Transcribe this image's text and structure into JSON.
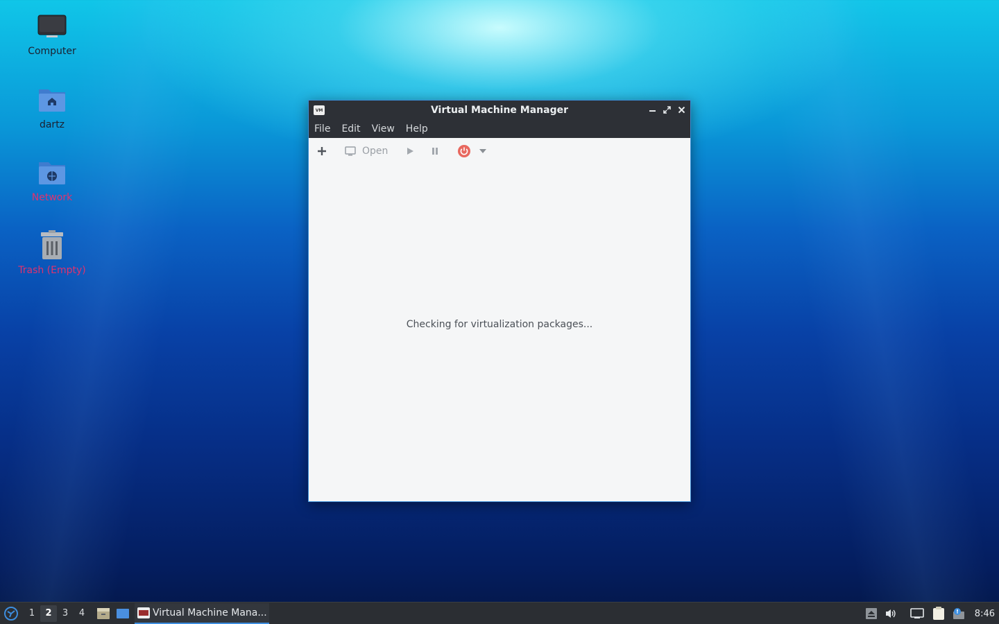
{
  "desktop": {
    "icons": [
      {
        "label": "Computer",
        "icon": "computer-icon"
      },
      {
        "label": "dartz",
        "icon": "home-folder-icon"
      },
      {
        "label": "Network",
        "icon": "network-folder-icon"
      },
      {
        "label": "Trash (Empty)",
        "icon": "trash-icon"
      }
    ]
  },
  "window": {
    "title": "Virtual Machine Manager",
    "app_icon_text": "VM",
    "menu": [
      "File",
      "Edit",
      "View",
      "Help"
    ],
    "toolbar": {
      "new_icon": "plus-icon",
      "open_label": "Open",
      "open_icon": "monitor-icon",
      "run_icon": "play-icon",
      "pause_icon": "pause-icon",
      "shutdown_icon": "power-icon",
      "shutdown_menu_icon": "chevron-down-icon"
    },
    "status_text": "Checking for virtualization packages..."
  },
  "taskbar": {
    "workspaces": [
      "1",
      "2",
      "3",
      "4"
    ],
    "active_workspace": "2",
    "task_label": "Virtual Machine Mana...",
    "clock": "8:46"
  },
  "colors": {
    "accent": "#3d8ee0",
    "titlebar": "#2d3036",
    "power_red": "#e8685f",
    "label_pink": "#e0326e"
  }
}
